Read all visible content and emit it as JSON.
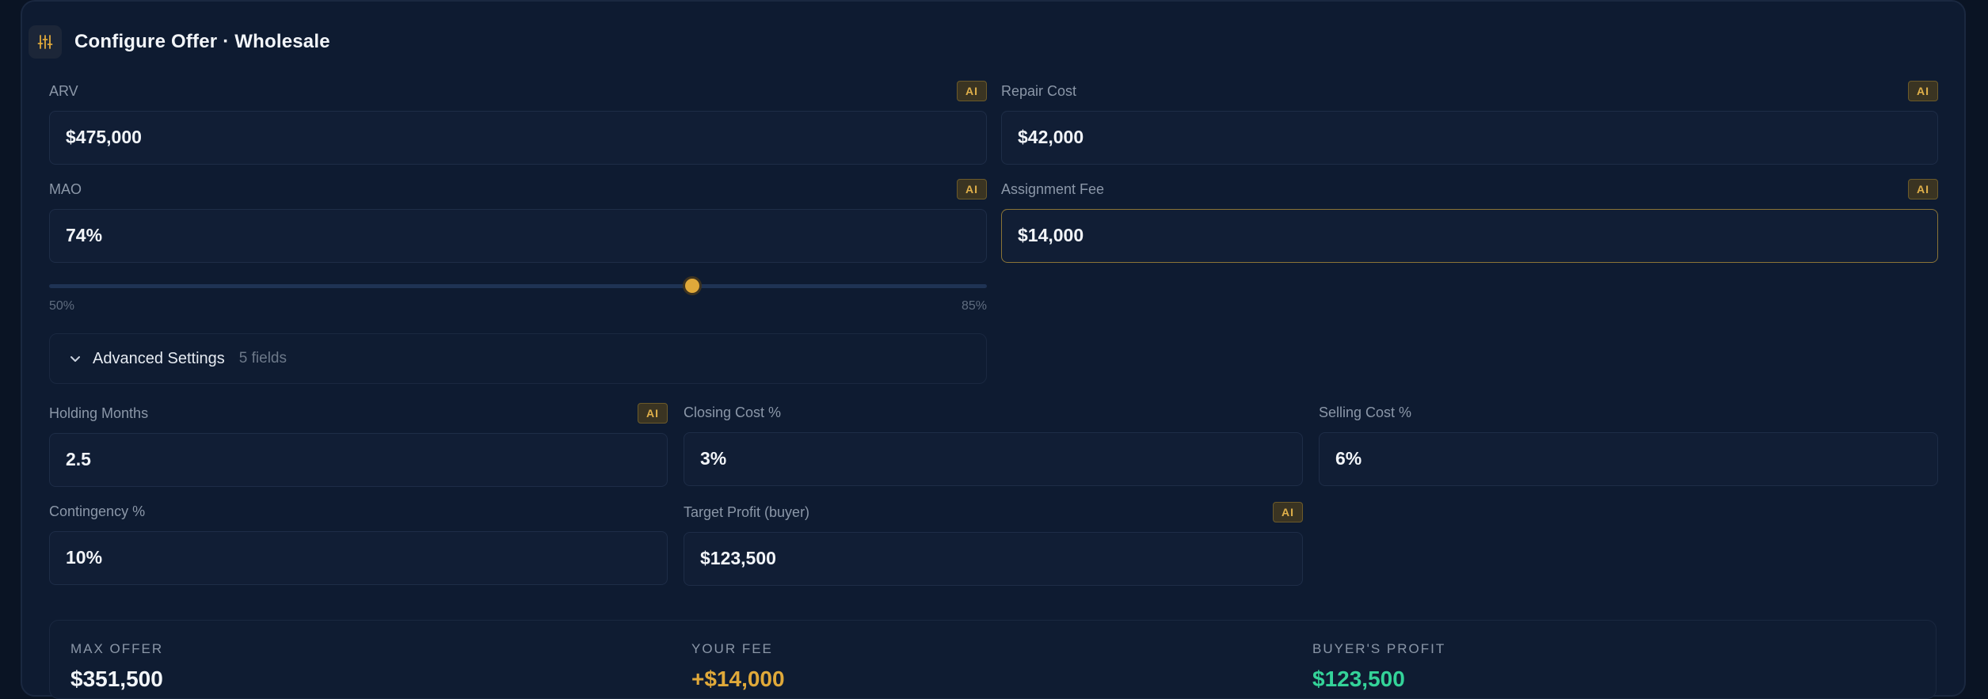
{
  "header": {
    "title": "Configure Offer · Wholesale",
    "icon": "sliders-icon"
  },
  "fields": {
    "arv": {
      "label": "ARV",
      "value": "$475,000",
      "ai": "AI"
    },
    "repair_cost": {
      "label": "Repair Cost",
      "value": "$42,000",
      "ai": "AI"
    },
    "mao": {
      "label": "MAO",
      "value": "74%",
      "ai": "AI"
    },
    "assignment_fee": {
      "label": "Assignment Fee",
      "value": "$14,000",
      "ai": "AI"
    }
  },
  "slider": {
    "min_label": "50%",
    "max_label": "85%",
    "min": 50,
    "max": 85,
    "value": 74
  },
  "advanced": {
    "label": "Advanced Settings",
    "count": "5 fields"
  },
  "advanced_fields": {
    "holding_months": {
      "label": "Holding Months",
      "value": "2.5",
      "ai": "AI"
    },
    "closing_cost": {
      "label": "Closing Cost %",
      "value": "3%"
    },
    "selling_cost": {
      "label": "Selling Cost %",
      "value": "6%"
    },
    "contingency": {
      "label": "Contingency %",
      "value": "10%"
    },
    "target_profit": {
      "label": "Target Profit (buyer)",
      "value": "$123,500",
      "ai": "AI"
    }
  },
  "summary": {
    "max_offer": {
      "label": "MAX OFFER",
      "value": "$351,500"
    },
    "your_fee": {
      "label": "YOUR FEE",
      "value": "+$14,000"
    },
    "buyers_profit": {
      "label": "BUYER'S PROFIT",
      "value": "$123,500"
    }
  },
  "colors": {
    "accent": "#e0a93a",
    "positive": "#34d399",
    "background": "#0e1b31"
  }
}
